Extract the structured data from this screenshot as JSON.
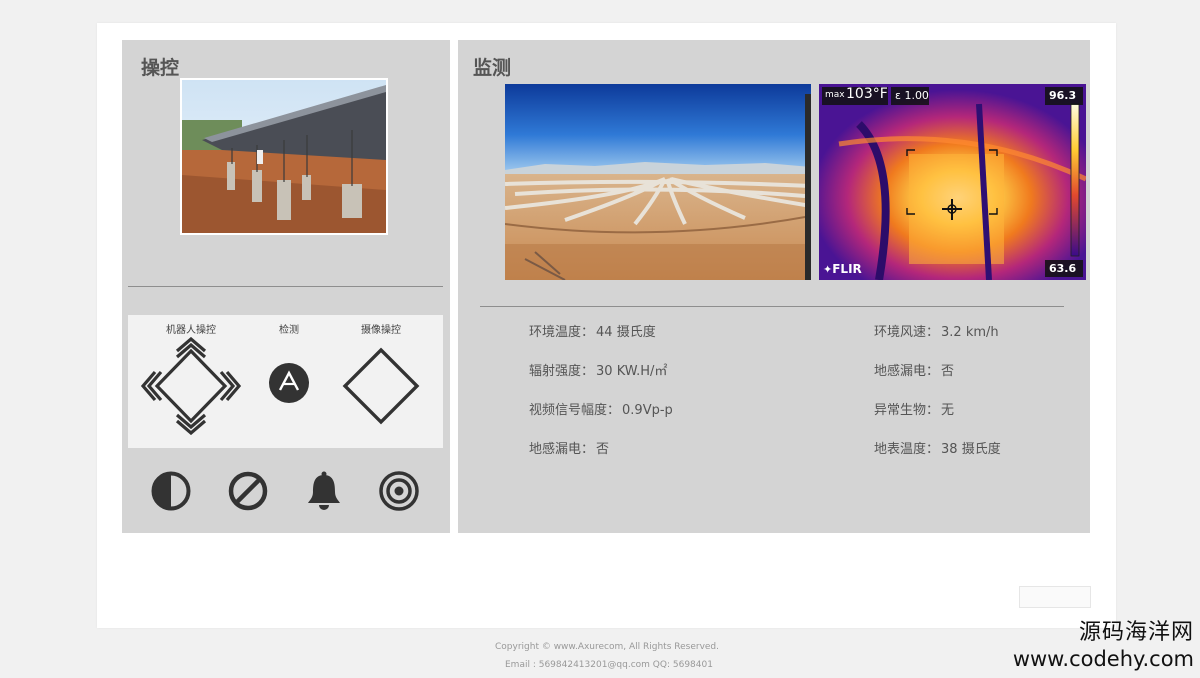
{
  "control": {
    "title": "操控",
    "labels": [
      "机器人操控",
      "检测",
      "摄像操控"
    ],
    "detect_glyph": "A",
    "tools": [
      "contrast-icon",
      "block-icon",
      "bell-icon",
      "target-icon"
    ]
  },
  "monitor": {
    "title": "监测",
    "thermal": {
      "max_prefix": "max",
      "max_value": "103°F",
      "emissivity": "ε 1.00",
      "scale_top": "96.3",
      "scale_bottom": "63.6",
      "brand": "FLIR"
    },
    "metrics_left": [
      {
        "label": "环境温度：",
        "value": "44 摄氏度"
      },
      {
        "label": "辐射强度：",
        "value": "30 KW.H/㎡"
      },
      {
        "label": "视频信号幅度：",
        "value": "0.9Vp-p"
      },
      {
        "label": "地感漏电：",
        "value": "否"
      }
    ],
    "metrics_right": [
      {
        "label": "环境风速：",
        "value": "3.2 km/h"
      },
      {
        "label": "地感漏电：",
        "value": "否"
      },
      {
        "label": "异常生物：",
        "value": "无"
      },
      {
        "label": "地表温度：",
        "value": "38 摄氏度"
      }
    ]
  },
  "footer": {
    "copyright": "Copyright © www.Axurecom, All Rights Reserved.",
    "email": "Email : 569842413201@qq.com   QQ: 5698401"
  },
  "watermark": {
    "cn": "源码海洋网",
    "url": "www.codehy.com"
  },
  "colors": {
    "panel_bg": "#d4d4d4",
    "icon_dark": "#333333",
    "card_bg": "#ffffff"
  }
}
